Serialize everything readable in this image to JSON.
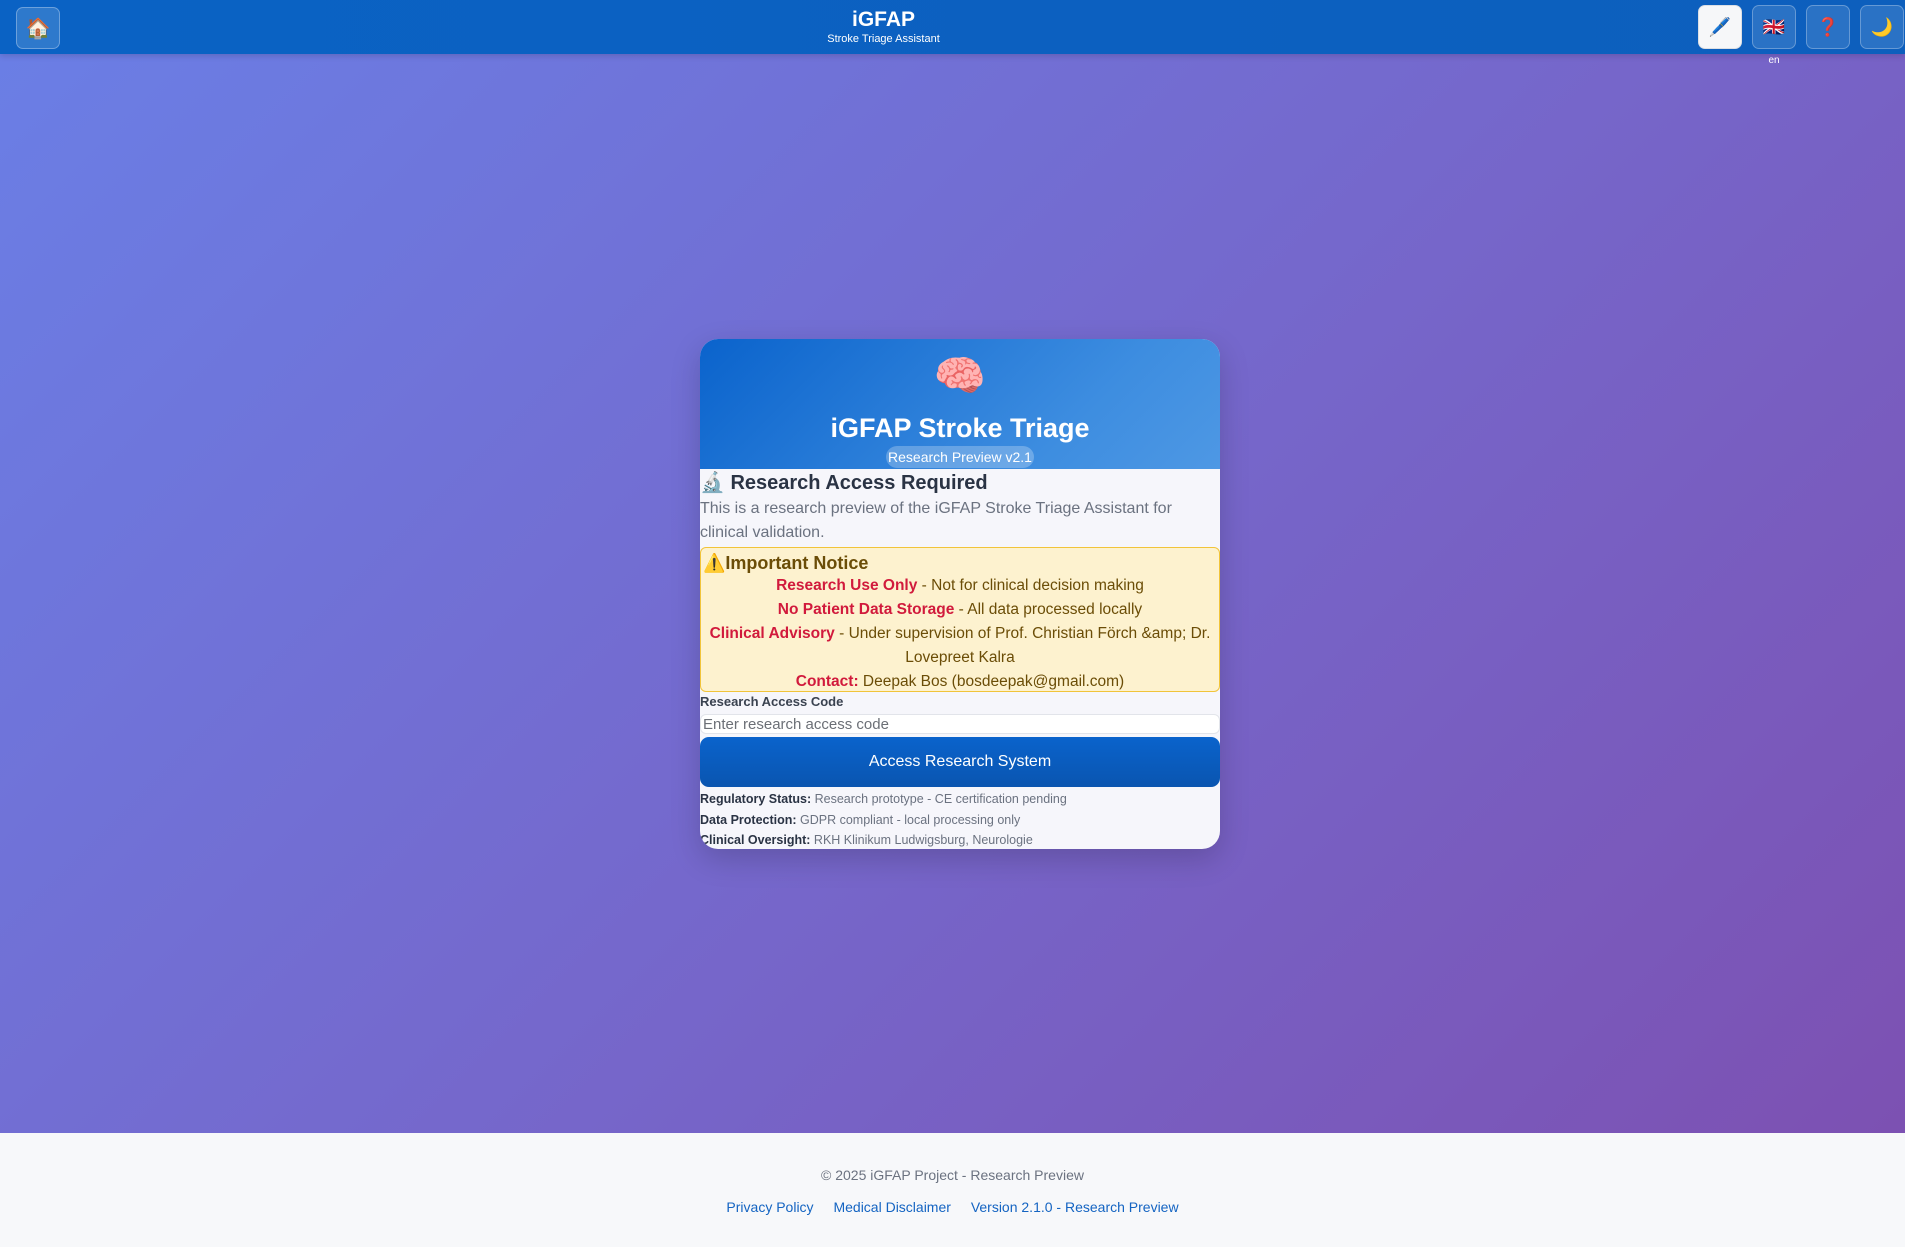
{
  "header": {
    "home_icon": "house-icon",
    "home_glyph": "🏠",
    "title": "iGFAP",
    "subtitle": "Stroke Triage Assistant",
    "buttons": [
      {
        "name": "pen-icon",
        "glyph": "🖊️"
      },
      {
        "name": "uk-flag-icon",
        "glyph": "🇬🇧"
      },
      {
        "name": "question-icon",
        "glyph": "❓"
      },
      {
        "name": "moon-icon",
        "glyph": "🌙"
      }
    ],
    "language": "en"
  },
  "card": {
    "brain_icon": "🧠",
    "title": "iGFAP Stroke Triage",
    "badge": "Research Preview v2.1",
    "access_title": "🔬 Research Access Required",
    "access_desc": "This is a research preview of the iGFAP Stroke Triage Assistant for clinical validation.",
    "notice": {
      "title": "⚠️Important Notice",
      "items": [
        {
          "label": "Research Use Only",
          "text": " - Not for clinical decision making"
        },
        {
          "label": "No Patient Data Storage",
          "text": " - All data processed locally"
        },
        {
          "label": "Clinical Advisory",
          "text": " - Under supervision of Prof. Christian Förch &amp; Dr. Lovepreet Kalra"
        },
        {
          "label": "Contact:",
          "text": " Deepak Bos (bosdeepak@gmail.com)"
        }
      ]
    },
    "code_label": "Research Access Code",
    "code_placeholder": "Enter research access code",
    "code_value": "",
    "submit_label": "Access Research System",
    "info": [
      {
        "label": "Regulatory Status:",
        "text": " Research prototype - CE certification pending"
      },
      {
        "label": "Data Protection:",
        "text": " GDPR compliant - local processing only"
      },
      {
        "label": "Clinical Oversight:",
        "text": " RKH Klinikum Ludwigsburg, Neurologie"
      }
    ]
  },
  "footer": {
    "copyright": "© 2025 iGFAP Project - Research Preview",
    "links": [
      "Privacy Policy",
      "Medical Disclaimer",
      "Version 2.1.0 - Research Preview"
    ]
  }
}
